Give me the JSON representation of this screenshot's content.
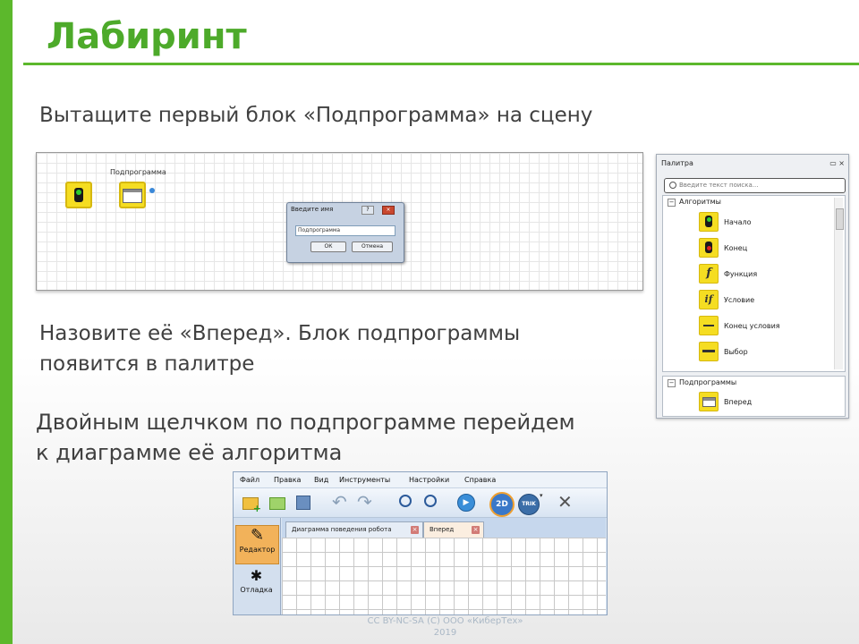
{
  "slide": {
    "title": "Лабиринт",
    "step1": "Вытащите первый блок «Подпрограмма» на сцену",
    "step2_line1": "Назовите её «Вперед». Блок подпрограммы",
    "step2_line2": "появится в палитре",
    "step3_line1": "Двойным щелчком по подпрограмме перейдем",
    "step3_line2": "к диаграмме её алгоритма",
    "footer_line1": "CC BY-NC-SA (C) ООО «КиберТех»",
    "footer_line2": "2019"
  },
  "colors": {
    "accent": "#5cb82c",
    "title": "#4daa2a",
    "block_yellow": "#f5dd22"
  },
  "scene": {
    "subprogram_label": "Подпрограмма",
    "dialog": {
      "title": "Введите имя",
      "value": "Подпрограмма",
      "ok_label": "ОК",
      "cancel_label": "Отмена"
    }
  },
  "palette": {
    "title": "Палитра",
    "search_placeholder": "Введите текст поиска...",
    "group_algorithms": "Алгоритмы",
    "items": [
      {
        "label": "Начало",
        "icon": "traffic-light-green-icon"
      },
      {
        "label": "Конец",
        "icon": "traffic-light-red-icon"
      },
      {
        "label": "Функция",
        "icon": "function-icon"
      },
      {
        "label": "Условие",
        "icon": "condition-icon"
      },
      {
        "label": "Конец условия",
        "icon": "end-condition-icon"
      },
      {
        "label": "Выбор",
        "icon": "switch-icon"
      }
    ],
    "group_subprograms": "Подпрограммы",
    "subprogram_item": "Вперед"
  },
  "editor": {
    "menu": [
      "Файл",
      "Правка",
      "Вид",
      "Инструменты",
      "Настройки",
      "Справка"
    ],
    "toolbar_2d": "2D",
    "toolbar_trik": "TRIK",
    "tabs": [
      "Диаграмма поведения робота",
      "Вперед"
    ],
    "side_editor": "Редактор",
    "side_debug": "Отладка"
  }
}
